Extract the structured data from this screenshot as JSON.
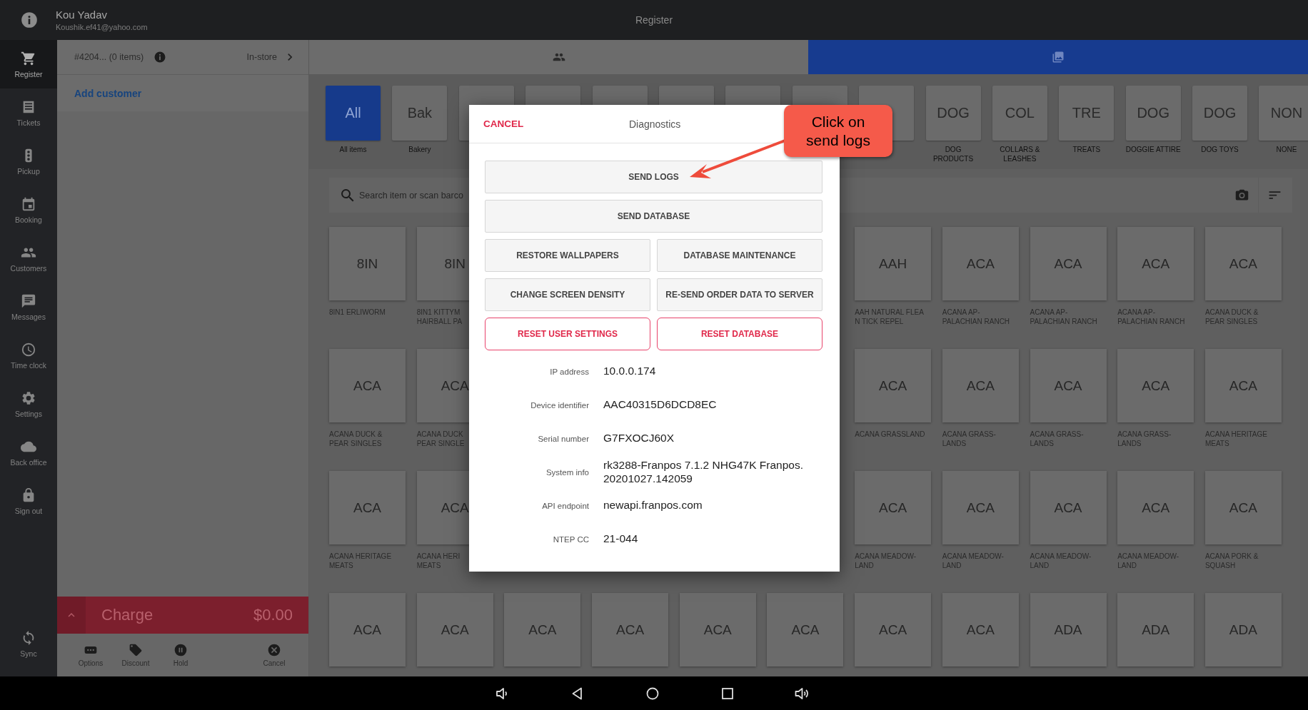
{
  "top_bar": {
    "user_name": "Kou Yadav",
    "user_email": "Koushik.ef41@yahoo.com",
    "title": "Register"
  },
  "nav": {
    "items": [
      {
        "label": "Register",
        "selected": true
      },
      {
        "label": "Tickets",
        "selected": false
      },
      {
        "label": "Pickup",
        "selected": false
      },
      {
        "label": "Booking",
        "selected": false
      },
      {
        "label": "Customers",
        "selected": false
      },
      {
        "label": "Messages",
        "selected": false
      },
      {
        "label": "Time clock",
        "selected": false
      },
      {
        "label": "Settings",
        "selected": false
      },
      {
        "label": "Back office",
        "selected": false
      },
      {
        "label": "Sign out",
        "selected": false
      }
    ],
    "sync": {
      "label": "Sync"
    }
  },
  "cart": {
    "order": "#4204... (0 items)",
    "order_type": "In-store",
    "add_customer": "Add customer",
    "charge": {
      "label": "Charge",
      "amount": "$0.00"
    },
    "actions": [
      {
        "label": "Options"
      },
      {
        "label": "Discount"
      },
      {
        "label": "Hold"
      },
      {
        "label": "Cancel"
      }
    ]
  },
  "tabs": [
    {
      "selected": false
    },
    {
      "selected": true
    }
  ],
  "categories": [
    {
      "code": "All",
      "label": "All items",
      "selected": true
    },
    {
      "code": "Bak",
      "label": "Bakery",
      "selected": false
    },
    {
      "selected": false
    },
    {
      "selected": false
    },
    {
      "selected": false
    },
    {
      "selected": false
    },
    {
      "selected": false
    },
    {
      "selected": false
    },
    {
      "selected": false
    },
    {
      "code": "DOG",
      "label": "DOG\nPRODUCTS",
      "selected": false
    },
    {
      "code": "COL",
      "label": "COLLARS &\nLEASHES",
      "selected": false
    },
    {
      "code": "TRE",
      "label": "TREATS",
      "selected": false
    },
    {
      "code": "DOG",
      "label": "DOGGIE ATTIRE",
      "selected": false
    },
    {
      "code": "DOG",
      "label": "DOG TOYS",
      "selected": false
    },
    {
      "code": "NON",
      "label": "NONE",
      "selected": false
    }
  ],
  "search": {
    "placeholder": "Search item or scan barco"
  },
  "products": {
    "rows": [
      {
        "left": [
          {
            "code": "8IN",
            "label": "8IN1 ERLIWORM"
          },
          {
            "code": "8IN",
            "label": "8IN1 KITTYM\nHAIRBALL PA"
          }
        ],
        "right": [
          {
            "code": "AAH",
            "label": "AAH NATURAL FLEA\nN TICK REPEL"
          },
          {
            "code": "ACA",
            "label": "ACANA AP-\nPALACHIAN RANCH"
          },
          {
            "code": "ACA",
            "label": "ACANA AP-\nPALACHIAN RANCH"
          },
          {
            "code": "ACA",
            "label": "ACANA AP-\nPALACHIAN RANCH"
          },
          {
            "code": "ACA",
            "label": "ACANA DUCK &\nPEAR SINGLES"
          }
        ]
      },
      {
        "left": [
          {
            "code": "ACA",
            "label": "ACANA DUCK &\nPEAR SINGLES"
          },
          {
            "code": "ACA",
            "label": "ACANA DUCK\nPEAR SINGLE"
          }
        ],
        "right": [
          {
            "code": "ACA",
            "label": "ACANA GRASSLAND"
          },
          {
            "code": "ACA",
            "label": "ACANA GRASS-\nLANDS"
          },
          {
            "code": "ACA",
            "label": "ACANA GRASS-\nLANDS"
          },
          {
            "code": "ACA",
            "label": "ACANA GRASS-\nLANDS"
          },
          {
            "code": "ACA",
            "label": "ACANA HERITAGE\nMEATS"
          }
        ]
      },
      {
        "left": [
          {
            "code": "ACA",
            "label": "ACANA HERITAGE\nMEATS"
          },
          {
            "code": "ACA",
            "label": "ACANA HERI\nMEATS"
          }
        ],
        "right": [
          {
            "code": "ACA",
            "label": "ACANA MEADOW-\nLAND"
          },
          {
            "code": "ACA",
            "label": "ACANA MEADOW-\nLAND"
          },
          {
            "code": "ACA",
            "label": "ACANA MEADOW-\nLAND"
          },
          {
            "code": "ACA",
            "label": "ACANA MEADOW-\nLAND"
          },
          {
            "code": "ACA",
            "label": "ACANA PORK &\nSQUASH"
          }
        ]
      },
      {
        "items": [
          {
            "code": "ACA"
          },
          {
            "code": "ACA"
          },
          {
            "code": "ACA"
          },
          {
            "code": "ACA"
          },
          {
            "code": "ACA"
          },
          {
            "code": "ACA"
          },
          {
            "code": "ACA"
          },
          {
            "code": "ACA"
          },
          {
            "code": "ADA"
          },
          {
            "code": "ADA"
          },
          {
            "code": "ADA"
          }
        ]
      }
    ]
  },
  "dialog": {
    "cancel": "CANCEL",
    "title": "Diagnostics",
    "buttons": [
      {
        "label": "SEND LOGS",
        "kind": "wide"
      },
      {
        "label": "SEND DATABASE",
        "kind": "wide"
      },
      {
        "label": "RESTORE WALLPAPERS",
        "kind": "half"
      },
      {
        "label": "DATABASE MAINTENANCE",
        "kind": "half"
      },
      {
        "label": "CHANGE SCREEN DENSITY",
        "kind": "half"
      },
      {
        "label": "RE-SEND ORDER DATA TO SERVER",
        "kind": "half"
      },
      {
        "label": "RESET USER SETTINGS",
        "kind": "danger"
      },
      {
        "label": "RESET DATABASE",
        "kind": "danger"
      }
    ],
    "info": [
      {
        "label": "IP address",
        "value": "10.0.0.174"
      },
      {
        "label": "Device identifier",
        "value": "AAC40315D6DCD8EC"
      },
      {
        "label": "Serial number",
        "value": "G7FXOCJ60X"
      },
      {
        "label": "System info",
        "value": "rk3288-Franpos 7.1.2 NHG47K Franpos.\n20201027.142059"
      },
      {
        "label": "API endpoint",
        "value": "newapi.franpos.com"
      },
      {
        "label": "NTEP CC",
        "value": "21-044"
      }
    ]
  },
  "callout": {
    "text": "Click on send logs"
  }
}
